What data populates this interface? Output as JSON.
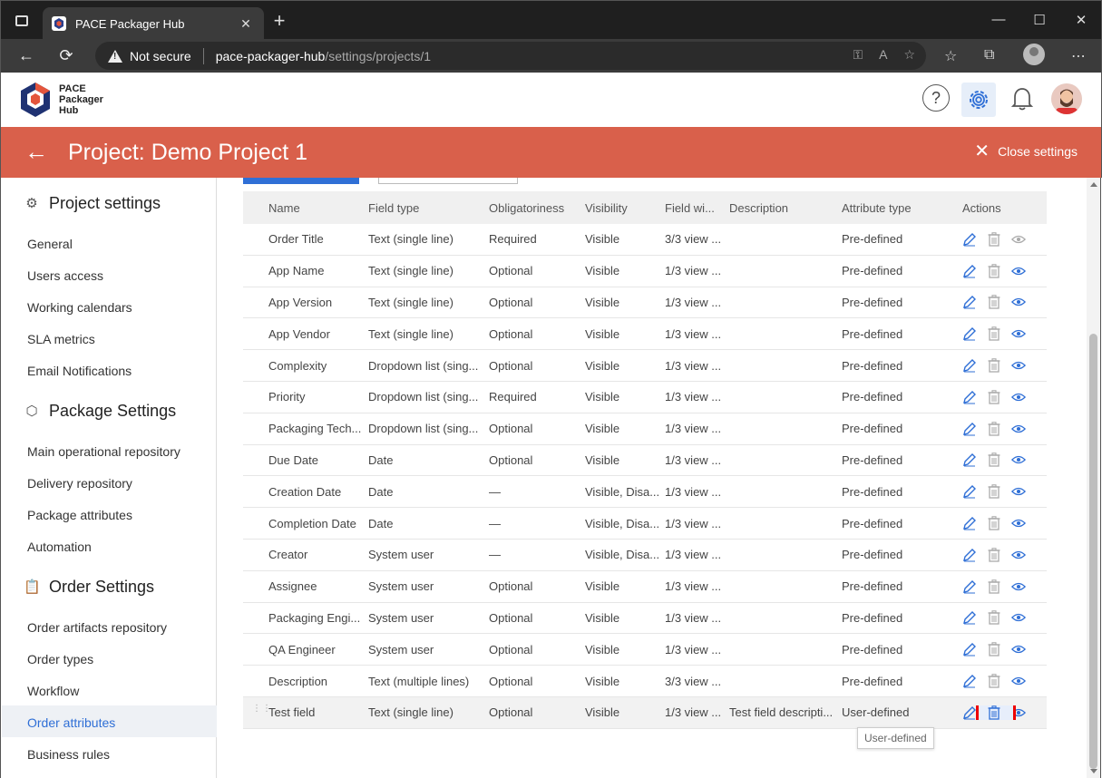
{
  "browser": {
    "tab_title": "PACE Packager Hub",
    "security_label": "Not secure",
    "url_host": "pace-packager-hub",
    "url_path": "/settings/projects/1"
  },
  "app": {
    "logo_line1": "PACE",
    "logo_line2": "Packager",
    "logo_line3": "Hub",
    "help_symbol": "?"
  },
  "title_bar": {
    "title": "Project: Demo Project 1",
    "close_label": "Close settings"
  },
  "sidebar": {
    "project_settings": {
      "title": "Project settings",
      "items": [
        "General",
        "Users access",
        "Working calendars",
        "SLA metrics",
        "Email Notifications"
      ]
    },
    "package_settings": {
      "title": "Package Settings",
      "items": [
        "Main operational repository",
        "Delivery repository",
        "Package attributes",
        "Automation"
      ]
    },
    "order_settings": {
      "title": "Order Settings",
      "items": [
        "Order artifacts repository",
        "Order types",
        "Workflow",
        "Order attributes",
        "Business rules"
      ]
    },
    "active_item": "Order attributes"
  },
  "table": {
    "headers": [
      "Name",
      "Field type",
      "Obligatoriness",
      "Visibility",
      "Field wi...",
      "Description",
      "Attribute type",
      "Actions"
    ],
    "rows": [
      [
        "Order Title",
        "Text (single line)",
        "Required",
        "Visible",
        "3/3 view ...",
        "",
        "Pre-defined"
      ],
      [
        "App Name",
        "Text (single line)",
        "Optional",
        "Visible",
        "1/3 view ...",
        "",
        "Pre-defined"
      ],
      [
        "App Version",
        "Text (single line)",
        "Optional",
        "Visible",
        "1/3 view ...",
        "",
        "Pre-defined"
      ],
      [
        "App Vendor",
        "Text (single line)",
        "Optional",
        "Visible",
        "1/3 view ...",
        "",
        "Pre-defined"
      ],
      [
        "Complexity",
        "Dropdown list (sing...",
        "Optional",
        "Visible",
        "1/3 view ...",
        "",
        "Pre-defined"
      ],
      [
        "Priority",
        "Dropdown list (sing...",
        "Required",
        "Visible",
        "1/3 view ...",
        "",
        "Pre-defined"
      ],
      [
        "Packaging Tech...",
        "Dropdown list (sing...",
        "Optional",
        "Visible",
        "1/3 view ...",
        "",
        "Pre-defined"
      ],
      [
        "Due Date",
        "Date",
        "Optional",
        "Visible",
        "1/3 view ...",
        "",
        "Pre-defined"
      ],
      [
        "Creation Date",
        "Date",
        "—",
        "Visible, Disa...",
        "1/3 view ...",
        "",
        "Pre-defined"
      ],
      [
        "Completion Date",
        "Date",
        "—",
        "Visible, Disa...",
        "1/3 view ...",
        "",
        "Pre-defined"
      ],
      [
        "Creator",
        "System user",
        "—",
        "Visible, Disa...",
        "1/3 view ...",
        "",
        "Pre-defined"
      ],
      [
        "Assignee",
        "System user",
        "Optional",
        "Visible",
        "1/3 view ...",
        "",
        "Pre-defined"
      ],
      [
        "Packaging Engi...",
        "System user",
        "Optional",
        "Visible",
        "1/3 view ...",
        "",
        "Pre-defined"
      ],
      [
        "QA Engineer",
        "System user",
        "Optional",
        "Visible",
        "1/3 view ...",
        "",
        "Pre-defined"
      ],
      [
        "Description",
        "Text (multiple lines)",
        "Optional",
        "Visible",
        "3/3 view ...",
        "",
        "Pre-defined"
      ],
      [
        "Test field",
        "Text (single line)",
        "Optional",
        "Visible",
        "1/3 view ...",
        "Test field descripti...",
        "User-defined"
      ]
    ],
    "first_row_visibility_icon_dimmed": true,
    "delete_enabled_row_index": 15
  },
  "tooltip": {
    "text": "User-defined"
  },
  "colors": {
    "accent": "#2f6fd6",
    "banner": "#d9604b",
    "highlight_border": "#e00000"
  },
  "icons": {
    "edit": "pencil-icon",
    "delete": "trash-icon",
    "visibility": "eye-icon"
  }
}
